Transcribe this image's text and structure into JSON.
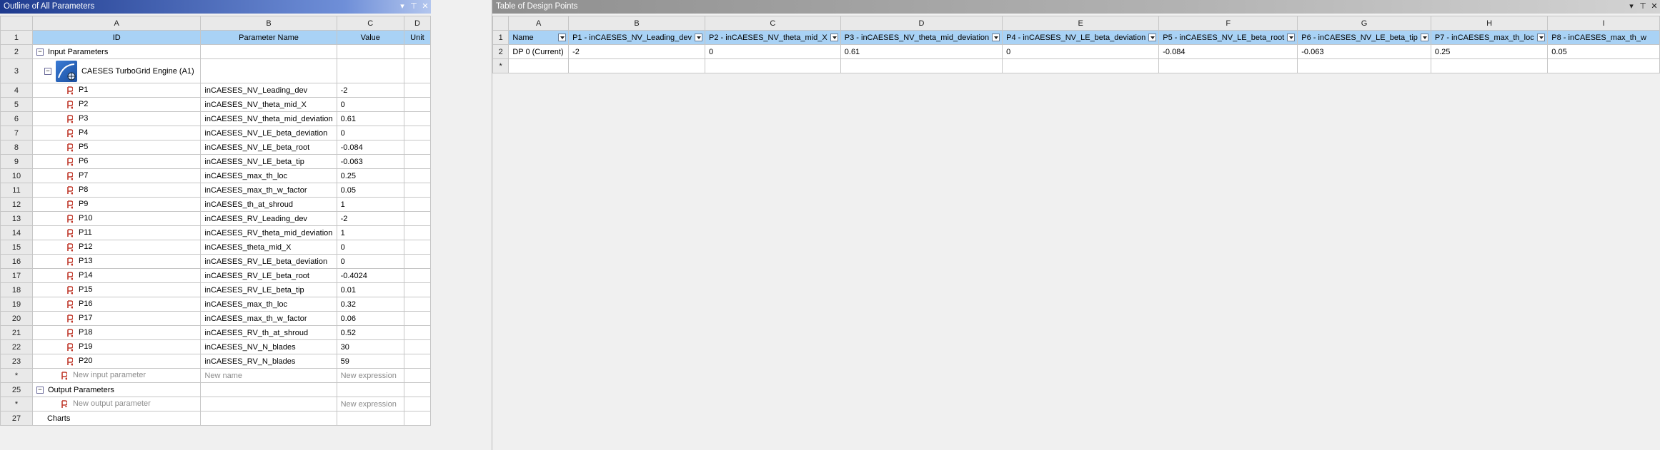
{
  "outline": {
    "title": "Outline of All Parameters",
    "columns": [
      "A",
      "B",
      "C",
      "D"
    ],
    "headers": [
      "ID",
      "Parameter Name",
      "Value",
      "Unit"
    ],
    "row_numbers": [
      "1",
      "2",
      "3",
      "4",
      "5",
      "6",
      "7",
      "8",
      "9",
      "10",
      "11",
      "12",
      "13",
      "14",
      "15",
      "16",
      "17",
      "18",
      "19",
      "20",
      "21",
      "22",
      "23",
      "*",
      "25",
      "*",
      "27"
    ],
    "input_group_label": "Input Parameters",
    "engine_label": "CAESES TurboGrid Engine (A1)",
    "params": [
      {
        "id": "P1",
        "name": "inCAESES_NV_Leading_dev",
        "value": "-2"
      },
      {
        "id": "P2",
        "name": "inCAESES_NV_theta_mid_X",
        "value": "0"
      },
      {
        "id": "P3",
        "name": "inCAESES_NV_theta_mid_deviation",
        "value": "0.61"
      },
      {
        "id": "P4",
        "name": "inCAESES_NV_LE_beta_deviation",
        "value": "0"
      },
      {
        "id": "P5",
        "name": "inCAESES_NV_LE_beta_root",
        "value": "-0.084"
      },
      {
        "id": "P6",
        "name": "inCAESES_NV_LE_beta_tip",
        "value": "-0.063"
      },
      {
        "id": "P7",
        "name": "inCAESES_max_th_loc",
        "value": "0.25"
      },
      {
        "id": "P8",
        "name": "inCAESES_max_th_w_factor",
        "value": "0.05"
      },
      {
        "id": "P9",
        "name": "inCAESES_th_at_shroud",
        "value": "1"
      },
      {
        "id": "P10",
        "name": "inCAESES_RV_Leading_dev",
        "value": "-2"
      },
      {
        "id": "P11",
        "name": "inCAESES_RV_theta_mid_deviation",
        "value": "1"
      },
      {
        "id": "P12",
        "name": "inCAESES_theta_mid_X",
        "value": "0"
      },
      {
        "id": "P13",
        "name": "inCAESES_RV_LE_beta_deviation",
        "value": "0"
      },
      {
        "id": "P14",
        "name": "inCAESES_RV_LE_beta_root",
        "value": "-0.4024"
      },
      {
        "id": "P15",
        "name": "inCAESES_RV_LE_beta_tip",
        "value": "0.01"
      },
      {
        "id": "P16",
        "name": "inCAESES_max_th_loc",
        "value": "0.32"
      },
      {
        "id": "P17",
        "name": "inCAESES_max_th_w_factor",
        "value": "0.06"
      },
      {
        "id": "P18",
        "name": "inCAESES_RV_th_at_shroud",
        "value": "0.52"
      },
      {
        "id": "P19",
        "name": "inCAESES_NV_N_blades",
        "value": "30"
      },
      {
        "id": "P20",
        "name": "inCAESES_RV_N_blades",
        "value": "59"
      }
    ],
    "new_input_placeholder": "New input parameter",
    "new_name_placeholder": "New name",
    "new_expression_placeholder": "New expression",
    "output_group_label": "Output Parameters",
    "new_output_placeholder": "New output parameter",
    "charts_label": "Charts"
  },
  "design_points": {
    "title": "Table of Design Points",
    "columns": [
      "A",
      "B",
      "C",
      "D",
      "E",
      "F",
      "G",
      "H",
      "I"
    ],
    "headers": [
      "Name",
      "P1 - inCAESES_NV_Leading_dev",
      "P2 - inCAESES_NV_theta_mid_X",
      "P3 - inCAESES_NV_theta_mid_deviation",
      "P4 - inCAESES_NV_LE_beta_deviation",
      "P5 - inCAESES_NV_LE_beta_root",
      "P6 - inCAESES_NV_LE_beta_tip",
      "P7 - inCAESES_max_th_loc",
      "P8 - inCAESES_max_th_w"
    ],
    "row_numbers": [
      "1",
      "2",
      "*"
    ],
    "rows": [
      [
        "DP 0 (Current)",
        "-2",
        "0",
        "0.61",
        "0",
        "-0.084",
        "-0.063",
        "0.25",
        "0.05"
      ]
    ]
  },
  "window_icons": {
    "dropdown": "▾",
    "pin": "⊤",
    "close": "✕"
  },
  "colors": {
    "outline_title_bg": "#1e3a8e",
    "design_title_bg": "#9a9a9a",
    "header_cell_bg": "#a9d2f5",
    "param_icon": "#c0392b"
  }
}
